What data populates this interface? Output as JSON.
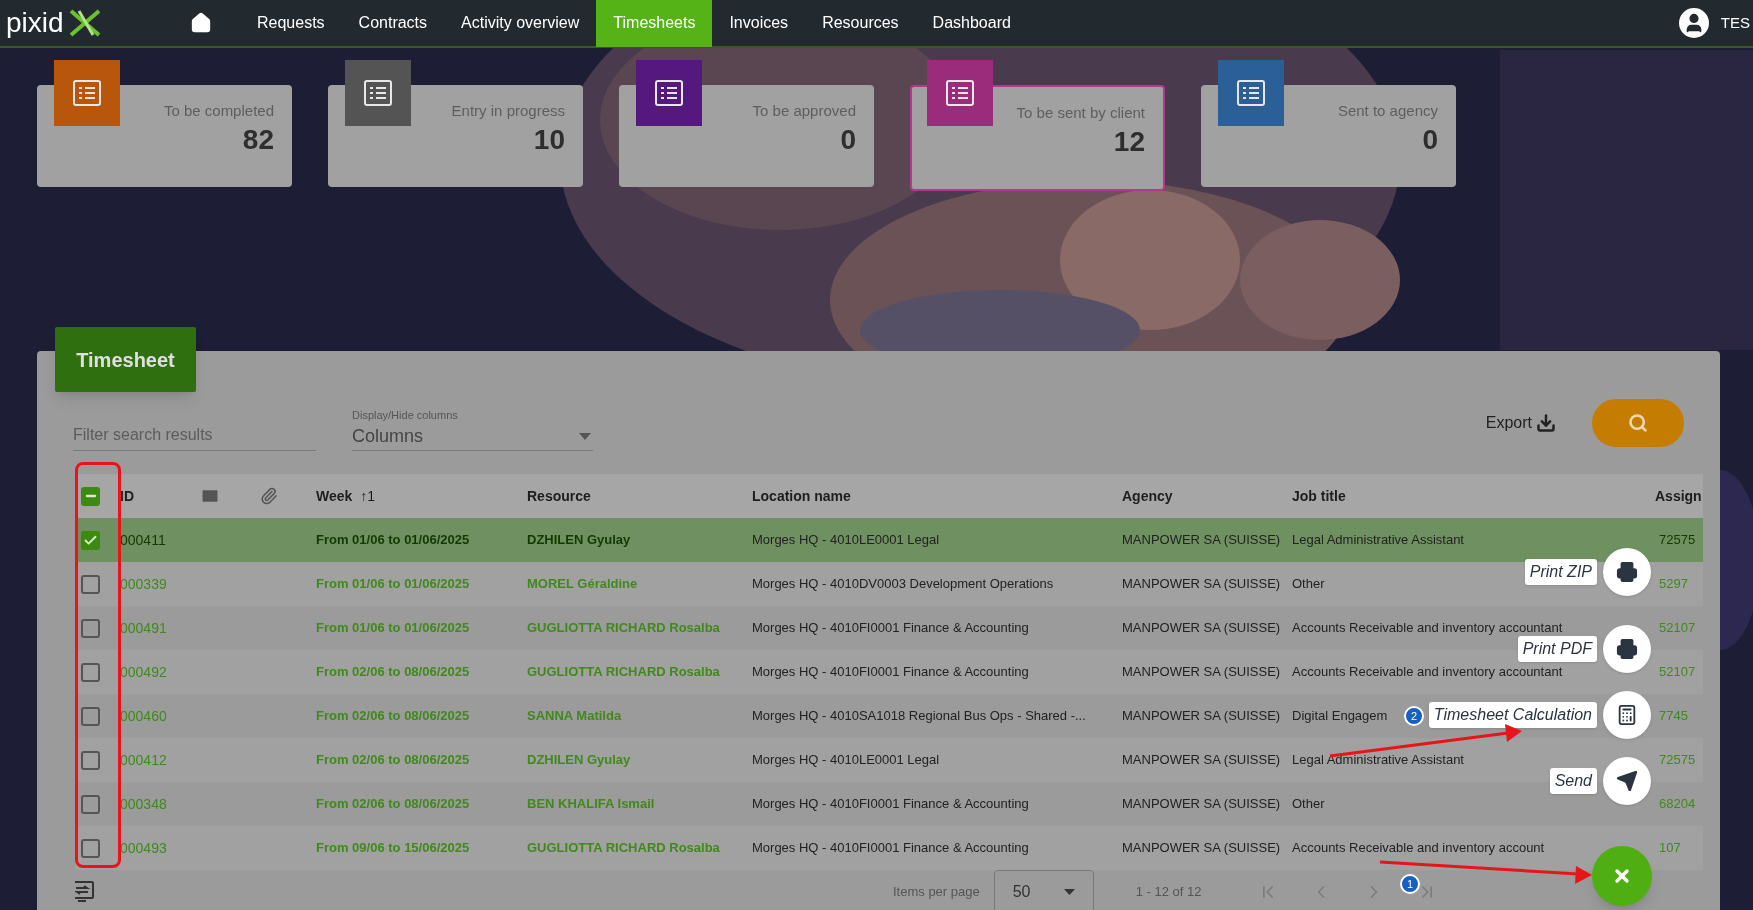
{
  "nav": {
    "logo": "pixid",
    "items": [
      {
        "label": "Requests",
        "selected": false
      },
      {
        "label": "Contracts",
        "selected": false
      },
      {
        "label": "Activity overview",
        "selected": false
      },
      {
        "label": "Timesheets",
        "selected": true
      },
      {
        "label": "Invoices",
        "selected": false
      },
      {
        "label": "Resources",
        "selected": false
      },
      {
        "label": "Dashboard",
        "selected": false
      }
    ],
    "user": "TES"
  },
  "cards": [
    {
      "title": "To be completed",
      "count": "82",
      "color": "#b8560c",
      "selected": false
    },
    {
      "title": "Entry in progress",
      "count": "10",
      "color": "#545454",
      "selected": false
    },
    {
      "title": "To be approved",
      "count": "0",
      "color": "#55187f",
      "selected": false
    },
    {
      "title": "To be sent by client",
      "count": "12",
      "color": "#9b2c7c",
      "selected": true
    },
    {
      "title": "Sent to agency",
      "count": "0",
      "color": "#2a5f97",
      "selected": false
    }
  ],
  "panel": {
    "title": "Timesheet",
    "filter": {
      "placeholder": "Filter search results"
    },
    "columns_select": {
      "label": "Display/Hide columns",
      "value": "Columns"
    },
    "export": "Export"
  },
  "table": {
    "select_all": {
      "indeterminate": true
    },
    "columns": [
      "ID",
      "Week",
      "↑1",
      "Resource",
      "Location name",
      "Agency",
      "Job title",
      "Assign"
    ],
    "rows": [
      {
        "id": "000411",
        "week": "From 01/06 to 01/06/2025",
        "resource": "DZHILEN Gyulay",
        "location": "Morges HQ - 4010LE0001 Legal",
        "agency": "MANPOWER SA (SUISSE)",
        "job": "Legal Administrative Assistant",
        "assignment": "72575",
        "selected": true
      },
      {
        "id": "000339",
        "week": "From 01/06 to 01/06/2025",
        "resource": "MOREL Géraldine",
        "location": "Morges HQ - 4010DV0003 Development Operations",
        "agency": "MANPOWER SA (SUISSE)",
        "job": "Other",
        "assignment": "5297",
        "selected": false
      },
      {
        "id": "000491",
        "week": "From 01/06 to 01/06/2025",
        "resource": "GUGLIOTTA RICHARD Rosalba",
        "location": "Morges HQ - 4010FI0001 Finance & Accounting",
        "agency": "MANPOWER SA (SUISSE)",
        "job": "Accounts Receivable and inventory accountant",
        "assignment": "52107",
        "selected": false
      },
      {
        "id": "000492",
        "week": "From 02/06 to 08/06/2025",
        "resource": "GUGLIOTTA RICHARD Rosalba",
        "location": "Morges HQ - 4010FI0001 Finance & Accounting",
        "agency": "MANPOWER SA (SUISSE)",
        "job": "Accounts Receivable and inventory accountant",
        "assignment": "52107",
        "selected": false
      },
      {
        "id": "000460",
        "week": "From 02/06 to 08/06/2025",
        "resource": "SANNA Matilda",
        "location": "Morges HQ - 4010SA1018 Regional Bus Ops - Shared -...",
        "agency": "MANPOWER SA (SUISSE)",
        "job": "Digital Engagem",
        "assignment": "7745",
        "selected": false
      },
      {
        "id": "000412",
        "week": "From 02/06 to 08/06/2025",
        "resource": "DZHILEN Gyulay",
        "location": "Morges HQ - 4010LE0001 Legal",
        "agency": "MANPOWER SA (SUISSE)",
        "job": "Legal Administrative Assistant",
        "assignment": "72575",
        "selected": false
      },
      {
        "id": "000348",
        "week": "From 02/06 to 08/06/2025",
        "resource": "BEN KHALIFA Ismail",
        "location": "Morges HQ - 4010FI0001 Finance & Accounting",
        "agency": "MANPOWER SA (SUISSE)",
        "job": "Other",
        "assignment": "68204",
        "selected": false
      },
      {
        "id": "000493",
        "week": "From 09/06 to 15/06/2025",
        "resource": "GUGLIOTTA RICHARD Rosalba",
        "location": "Morges HQ - 4010FI0001 Finance & Accounting",
        "agency": "MANPOWER SA (SUISSE)",
        "job": "Accounts Receivable and inventory account",
        "assignment": "107",
        "selected": false
      }
    ]
  },
  "pagination": {
    "label": "Items per page",
    "page_size": "50",
    "range": "1 - 12 of 12"
  },
  "actions": [
    {
      "label": "Print ZIP",
      "kind": "print"
    },
    {
      "label": "Print PDF",
      "kind": "print"
    },
    {
      "label": "Timesheet Calculation",
      "kind": "calculate"
    },
    {
      "label": "Send",
      "kind": "send"
    }
  ],
  "annotations": [
    {
      "number": "2"
    },
    {
      "number": "1"
    }
  ]
}
